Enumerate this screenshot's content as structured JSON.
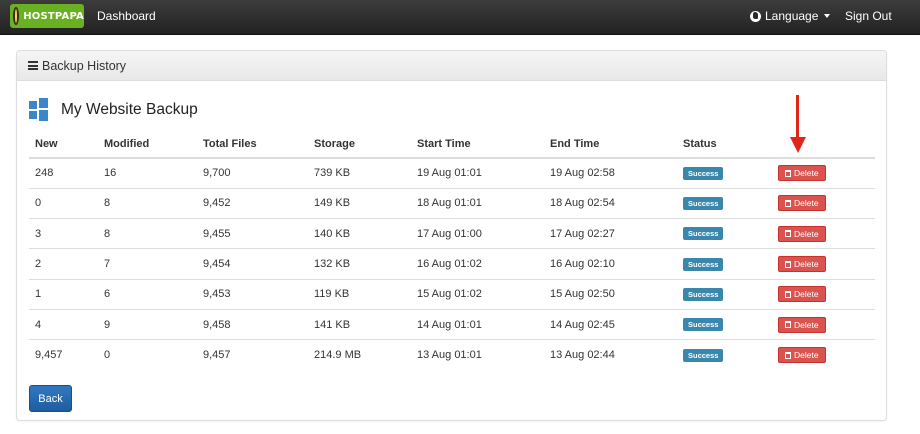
{
  "navbar": {
    "logo_text": "HOSTPAPA",
    "dashboard": "Dashboard",
    "language": "Language",
    "sign_out": "Sign Out"
  },
  "panel": {
    "heading": "Backup History",
    "section_title": "My Website Backup"
  },
  "table": {
    "headers": [
      "New",
      "Modified",
      "Total Files",
      "Storage",
      "Start Time",
      "End Time",
      "Status"
    ],
    "status_label": "Success",
    "delete_label": "Delete",
    "rows": [
      {
        "new": "248",
        "modified": "16",
        "total_files": "9,700",
        "storage": "739 KB",
        "start": "19 Aug 01:01",
        "end": "19 Aug 02:58"
      },
      {
        "new": "0",
        "modified": "8",
        "total_files": "9,452",
        "storage": "149 KB",
        "start": "18 Aug 01:01",
        "end": "18 Aug 02:54"
      },
      {
        "new": "3",
        "modified": "8",
        "total_files": "9,455",
        "storage": "140 KB",
        "start": "17 Aug 01:00",
        "end": "17 Aug 02:27"
      },
      {
        "new": "2",
        "modified": "7",
        "total_files": "9,454",
        "storage": "132 KB",
        "start": "16 Aug 01:02",
        "end": "16 Aug 02:10"
      },
      {
        "new": "1",
        "modified": "6",
        "total_files": "9,453",
        "storage": "119 KB",
        "start": "15 Aug 01:02",
        "end": "15 Aug 02:50"
      },
      {
        "new": "4",
        "modified": "9",
        "total_files": "9,458",
        "storage": "141 KB",
        "start": "14 Aug 01:01",
        "end": "14 Aug 02:45"
      },
      {
        "new": "9,457",
        "modified": "0",
        "total_files": "9,457",
        "storage": "214.9 MB",
        "start": "13 Aug 01:01",
        "end": "13 Aug 02:44"
      }
    ]
  },
  "back_label": "Back",
  "colors": {
    "success": "#3a87ad",
    "danger": "#d9534f",
    "primary": "#2a6db5",
    "annotation_arrow": "#e0261b"
  }
}
